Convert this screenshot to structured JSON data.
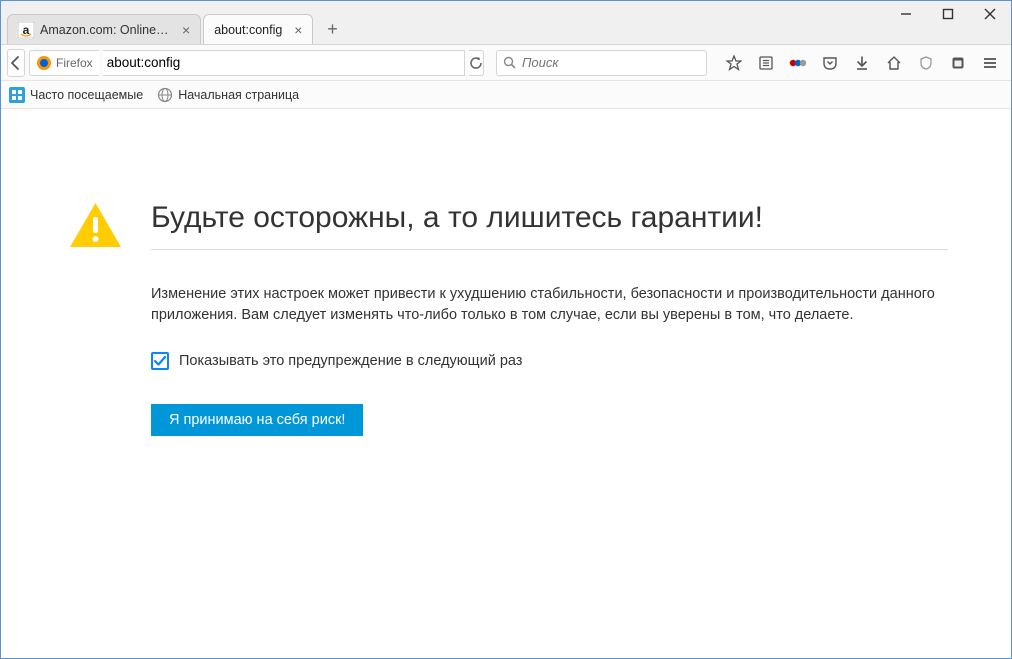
{
  "window": {
    "tabs": [
      {
        "title": "Amazon.com: Online Sho...",
        "active": false
      },
      {
        "title": "about:config",
        "active": true
      }
    ]
  },
  "toolbar": {
    "identity": "Firefox",
    "url": "about:config",
    "search_placeholder": "Поиск"
  },
  "bookmarks": [
    {
      "label": "Часто посещаемые"
    },
    {
      "label": "Начальная страница"
    }
  ],
  "page": {
    "heading": "Будьте осторожны, а то лишитесь гарантии!",
    "description": "Изменение этих настроек может привести к ухудшению стабильности, безопасности и производительности данного приложения. Вам следует изменять что-либо только в том случае, если вы уверены в том, что делаете.",
    "checkbox_label": "Показывать это предупреждение в следующий раз",
    "checkbox_checked": true,
    "accept_label": "Я принимаю на себя риск!"
  }
}
